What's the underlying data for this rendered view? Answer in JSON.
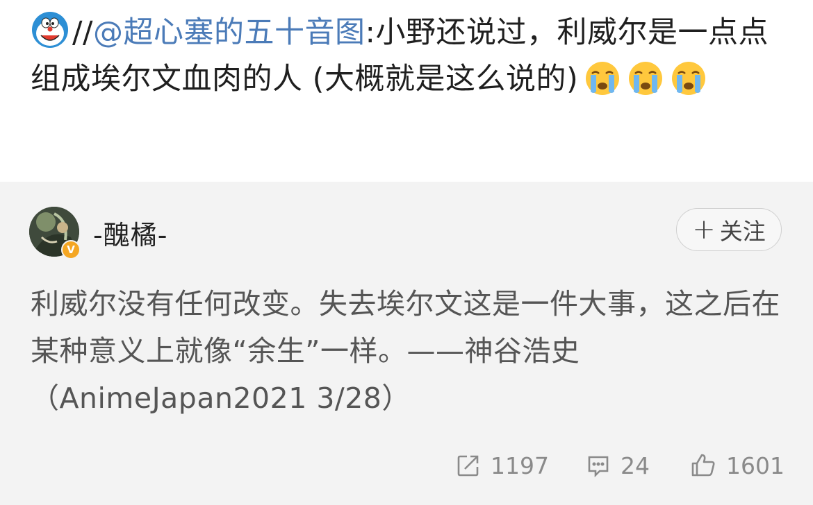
{
  "repost": {
    "prefix": "//",
    "mention": "@超心塞的五十音图",
    "text": ":小野还说过，利威尔是一点点组成埃尔文血肉的人 (大概就是这么说的)",
    "emoji_icon": "doraemon-icon",
    "crying_icons": [
      "crying-face-icon",
      "crying-face-icon",
      "crying-face-icon"
    ]
  },
  "original": {
    "username": "-醜橘-",
    "verified": true,
    "follow_label": "关注",
    "follow_icon": "plus-icon",
    "text": "利威尔没有任何改变。失去埃尔文这是一件大事，这之后在某种意义上就像“余生”一样。——神谷浩史 （AnimeJapan2021 3/28）"
  },
  "actions": {
    "repost_count": "1197",
    "comment_count": "24",
    "like_count": "1601"
  },
  "colors": {
    "mention": "#4b7bb8",
    "card_background": "#f3f3f3",
    "action_gray": "#8a8a8a",
    "verified_badge": "#f4a623"
  }
}
